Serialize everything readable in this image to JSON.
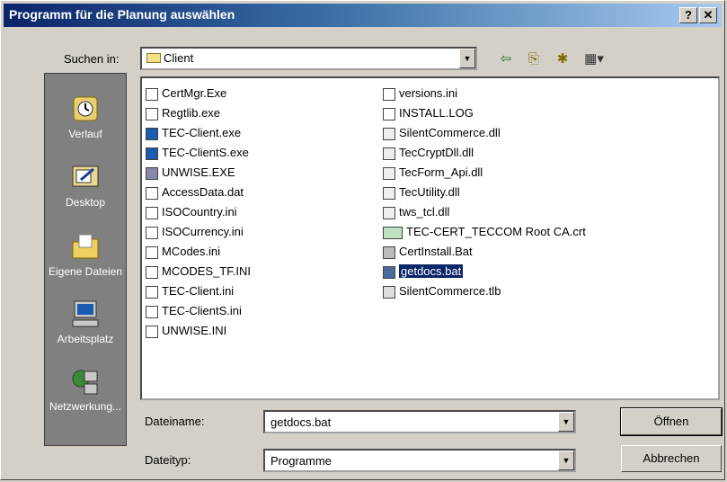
{
  "window": {
    "title": "Programm für die Planung auswählen",
    "help_btn": "?",
    "close_btn": "✕"
  },
  "lookin": {
    "label": "Suchen in:",
    "value": "Client"
  },
  "toolbar": {
    "back_icon": "arrow-left-icon",
    "up_icon": "folder-up-icon",
    "new_folder_icon": "new-folder-icon",
    "view_icon": "view-menu-icon"
  },
  "places": [
    {
      "label": "Verlauf",
      "icon": "history-icon"
    },
    {
      "label": "Desktop",
      "icon": "desktop-icon"
    },
    {
      "label": "Eigene Dateien",
      "icon": "my-documents-icon"
    },
    {
      "label": "Arbeitsplatz",
      "icon": "my-computer-icon"
    },
    {
      "label": "Netzwerkung...",
      "icon": "network-icon"
    }
  ],
  "files_col1": [
    "CertMgr.Exe",
    "Regtlib.exe",
    "TEC-Client.exe",
    "TEC-ClientS.exe",
    "UNWISE.EXE",
    "AccessData.dat",
    "ISOCountry.ini",
    "ISOCurrency.ini",
    "MCodes.ini",
    "MCODES_TF.INI",
    "TEC-Client.ini",
    "TEC-ClientS.ini",
    "UNWISE.INI"
  ],
  "files_col2": [
    "versions.ini",
    "INSTALL.LOG",
    "SilentCommerce.dll",
    "TecCryptDll.dll",
    "TecForm_Api.dll",
    "TecUtility.dll",
    "tws_tcl.dll",
    "TEC-CERT_TECCOM Root CA.crt",
    "CertInstall.Bat",
    "getdocs.bat",
    "SilentCommerce.tlb"
  ],
  "selected_file": "getdocs.bat",
  "filename": {
    "label": "Dateiname:",
    "value": "getdocs.bat"
  },
  "filetype": {
    "label": "Dateityp:",
    "value": "Programme"
  },
  "buttons": {
    "open": "Öffnen",
    "cancel": "Abbrechen"
  },
  "colors": {
    "title_start": "#0a246a",
    "title_end": "#a6caf0",
    "selection": "#0a246a",
    "face": "#d4d0c8"
  }
}
